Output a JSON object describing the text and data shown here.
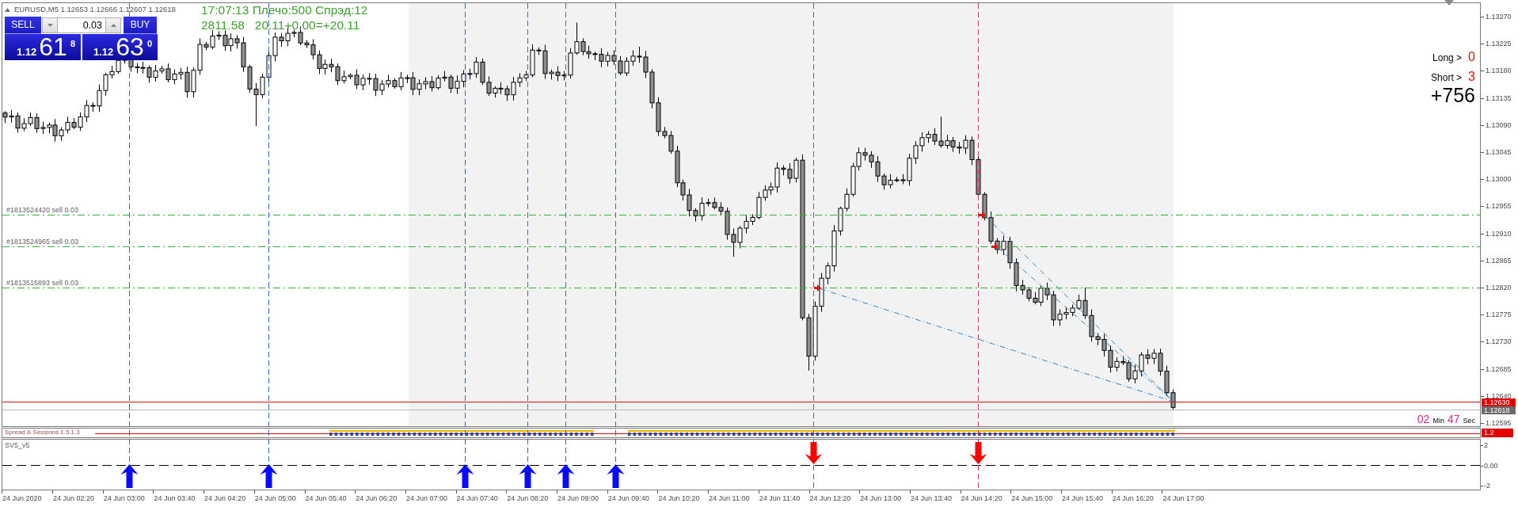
{
  "chart_header": {
    "symbol_info": "EURUSD,M5 1.12653 1.12666 1.12607 1.12618"
  },
  "trade_panel": {
    "sell_button": "SELL",
    "lot": "0.03",
    "buy_button": "BUY",
    "sell_quote": {
      "big_figure": "1.12",
      "pips": "61",
      "fraction": "8"
    },
    "buy_quote": {
      "big_figure": "1.12",
      "pips": "63",
      "fraction": "0"
    }
  },
  "account_info": [
    "17:07:13 Плечо:500 Спрэд:12",
    "2811.58   20.11+0.00=+20.11"
  ],
  "positions": {
    "long_label": "Long >",
    "long_count": "0",
    "short_label": "Short >",
    "short_count": "3",
    "total": "+756"
  },
  "order_lines": [
    {
      "label": "#1813524420 sell 0.03"
    },
    {
      "label": "#1813524965 sell 0.03"
    },
    {
      "label": "#1813516893 sell 0.03"
    }
  ],
  "price_axis": {
    "ticks": [
      "1.13270",
      "1.13225",
      "1.13180",
      "1.13135",
      "1.13090",
      "1.13045",
      "1.13000",
      "1.12955",
      "1.12910",
      "1.12865",
      "1.12820",
      "1.12775",
      "1.12730",
      "1.12685",
      "1.12640",
      "1.12595"
    ],
    "ask_label": "1.12630",
    "bid_label": "1.12618"
  },
  "bar_timer": {
    "minutes": "02",
    "minutes_unit": "Min",
    "seconds": "47",
    "seconds_unit": "Sec"
  },
  "spread_sessions": {
    "title": "Spread & Sessions 1.5.1.3",
    "value_label": "1.2"
  },
  "sv5_indicator": {
    "title": "SV5_v5",
    "ticks": [
      "2",
      "0.00",
      "-2"
    ]
  },
  "signals": [
    {
      "kind": "buy"
    },
    {
      "kind": "buy"
    },
    {
      "kind": "buy"
    },
    {
      "kind": "buy"
    },
    {
      "kind": "buy"
    },
    {
      "kind": "buy"
    },
    {
      "kind": "sell"
    },
    {
      "kind": "sell"
    }
  ],
  "time_axis": {
    "labels": [
      "24 Jun 2020",
      "24 Jun 02:20",
      "24 Jun 03:00",
      "24 Jun 03:40",
      "24 Jun 04:20",
      "24 Jun 05:00",
      "24 Jun 05:40",
      "24 Jun 06:20",
      "24 Jun 07:00",
      "24 Jun 07:40",
      "24 Jun 08:20",
      "24 Jun 09:00",
      "24 Jun 09:40",
      "24 Jun 10:20",
      "24 Jun 11:00",
      "24 Jun 11:40",
      "24 Jun 12:20",
      "24 Jun 13:00",
      "24 Jun 13:40",
      "24 Jun 14:20",
      "24 Jun 15:00",
      "24 Jun 15:40",
      "24 Jun 16:20",
      "24 Jun 17:00"
    ]
  }
}
